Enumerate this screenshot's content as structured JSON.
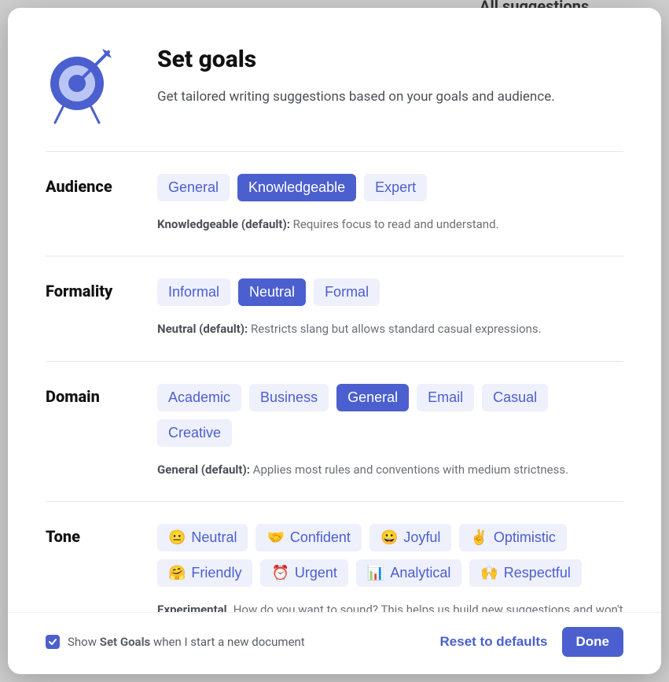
{
  "backdrop": {
    "link": "All suggestions"
  },
  "header": {
    "title": "Set goals",
    "subtitle": "Get tailored writing suggestions based on your goals and audience."
  },
  "sections": {
    "audience": {
      "label": "Audience",
      "options": {
        "general": "General",
        "knowledgeable": "Knowledgeable",
        "expert": "Expert"
      },
      "desc_strong": "Knowledgeable (default):",
      "desc_rest": " Requires focus to read and understand."
    },
    "formality": {
      "label": "Formality",
      "options": {
        "informal": "Informal",
        "neutral": "Neutral",
        "formal": "Formal"
      },
      "desc_strong": "Neutral (default):",
      "desc_rest": " Restricts slang but allows standard casual expressions."
    },
    "domain": {
      "label": "Domain",
      "options": {
        "academic": "Academic",
        "business": "Business",
        "general": "General",
        "email": "Email",
        "casual": "Casual",
        "creative": "Creative"
      },
      "desc_strong": "General (default):",
      "desc_rest": " Applies most rules and conventions with medium strictness."
    },
    "tone": {
      "label": "Tone",
      "options": {
        "neutral": {
          "emoji": "😐",
          "label": "Neutral"
        },
        "confident": {
          "emoji": "🤝",
          "label": "Confident"
        },
        "joyful": {
          "emoji": "😀",
          "label": "Joyful"
        },
        "optimistic": {
          "emoji": "✌️",
          "label": "Optimistic"
        },
        "friendly": {
          "emoji": "🤗",
          "label": "Friendly"
        },
        "urgent": {
          "emoji": "⏰",
          "label": "Urgent"
        },
        "analytical": {
          "emoji": "📊",
          "label": "Analytical"
        },
        "respectful": {
          "emoji": "🙌",
          "label": "Respectful"
        }
      },
      "desc_strong": "Experimental.",
      "desc_rest": " How do you want to sound? This helps us build new suggestions and won't affect your feedback today."
    }
  },
  "footer": {
    "checkbox_pre": "Show ",
    "checkbox_strong": "Set Goals",
    "checkbox_post": " when I start a new document",
    "reset": "Reset to defaults",
    "done": "Done"
  }
}
